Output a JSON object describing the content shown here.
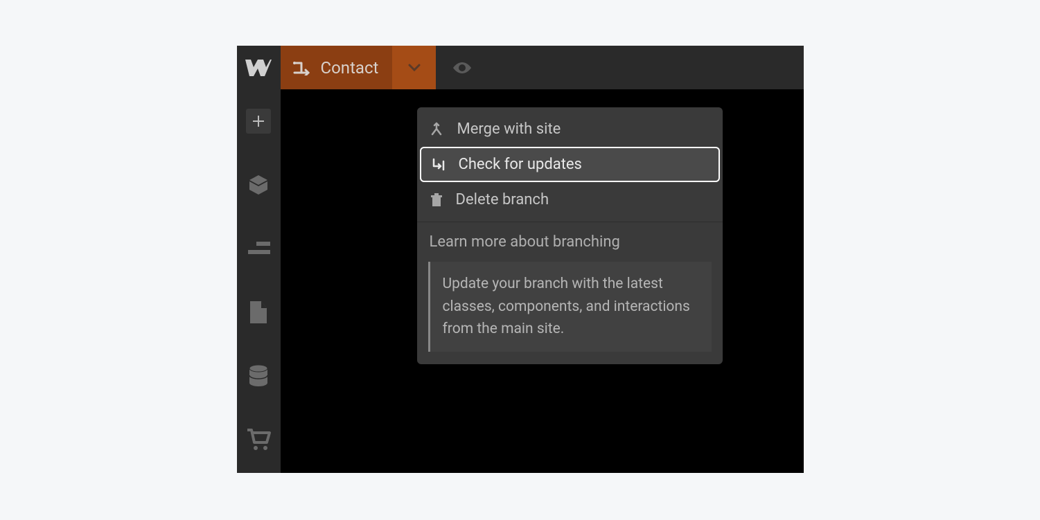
{
  "topbar": {
    "page_label": "Contact"
  },
  "dropdown": {
    "items": [
      {
        "label": "Merge with site"
      },
      {
        "label": "Check for updates"
      },
      {
        "label": "Delete branch"
      }
    ],
    "learn_more": "Learn more about branching",
    "description": "Update your branch with the latest classes, components, and interactions from the main site."
  }
}
